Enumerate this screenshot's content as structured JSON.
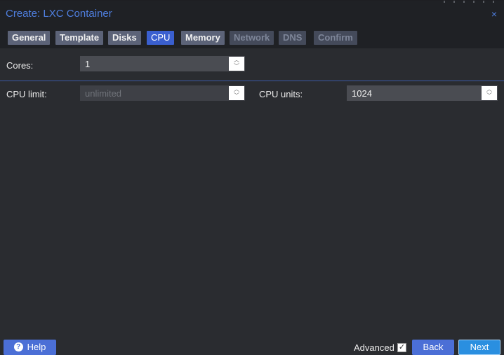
{
  "window": {
    "title": "Create: LXC Container",
    "close_glyph": "×"
  },
  "tabs": [
    {
      "label": "General",
      "state": "normal"
    },
    {
      "label": "Template",
      "state": "normal"
    },
    {
      "label": "Disks",
      "state": "normal"
    },
    {
      "label": "CPU",
      "state": "active"
    },
    {
      "label": "Memory",
      "state": "normal"
    },
    {
      "label": "Network",
      "state": "disabled"
    },
    {
      "label": "DNS",
      "state": "disabled"
    },
    {
      "label": "Confirm",
      "state": "disabled"
    }
  ],
  "form": {
    "cores": {
      "label": "Cores:",
      "value": "1"
    },
    "cpu_limit": {
      "label": "CPU limit:",
      "value": "unlimited",
      "disabled": true
    },
    "cpu_units": {
      "label": "CPU units:",
      "value": "1024"
    }
  },
  "footer": {
    "help_label": "Help",
    "help_icon": "question-circle-icon",
    "advanced_label": "Advanced",
    "advanced_checked": true,
    "back_label": "Back",
    "next_label": "Next"
  },
  "colors": {
    "accent": "#4f7fe0",
    "active_tab": "#3a5fcf",
    "primary_button": "#4b6fd6",
    "next_button": "#2a8fe0"
  }
}
